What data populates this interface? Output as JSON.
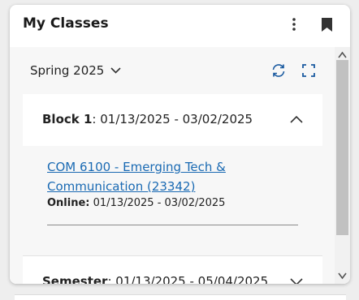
{
  "widget": {
    "title": "My Classes",
    "more_icon": "kebab-menu-icon",
    "bookmark_icon": "bookmark-icon"
  },
  "term": {
    "selected": "Spring 2025",
    "refresh_icon": "refresh-icon",
    "expand_icon": "fullscreen-icon"
  },
  "panels": [
    {
      "label": "Block 1",
      "dates": ": 01/13/2025 - 03/02/2025",
      "expanded": true,
      "courses": [
        {
          "title": "COM 6100 - Emerging Tech & Communication (23342)",
          "mode_label": "Online:",
          "mode_dates": "01/13/2025 - 03/02/2025"
        }
      ]
    },
    {
      "label": "Semester",
      "dates": ": 01/13/2025 - 05/04/2025",
      "expanded": false
    }
  ],
  "colors": {
    "link": "#1a6ab3",
    "panel_bg": "#ffffff",
    "area_bg": "#f7f7f7"
  }
}
